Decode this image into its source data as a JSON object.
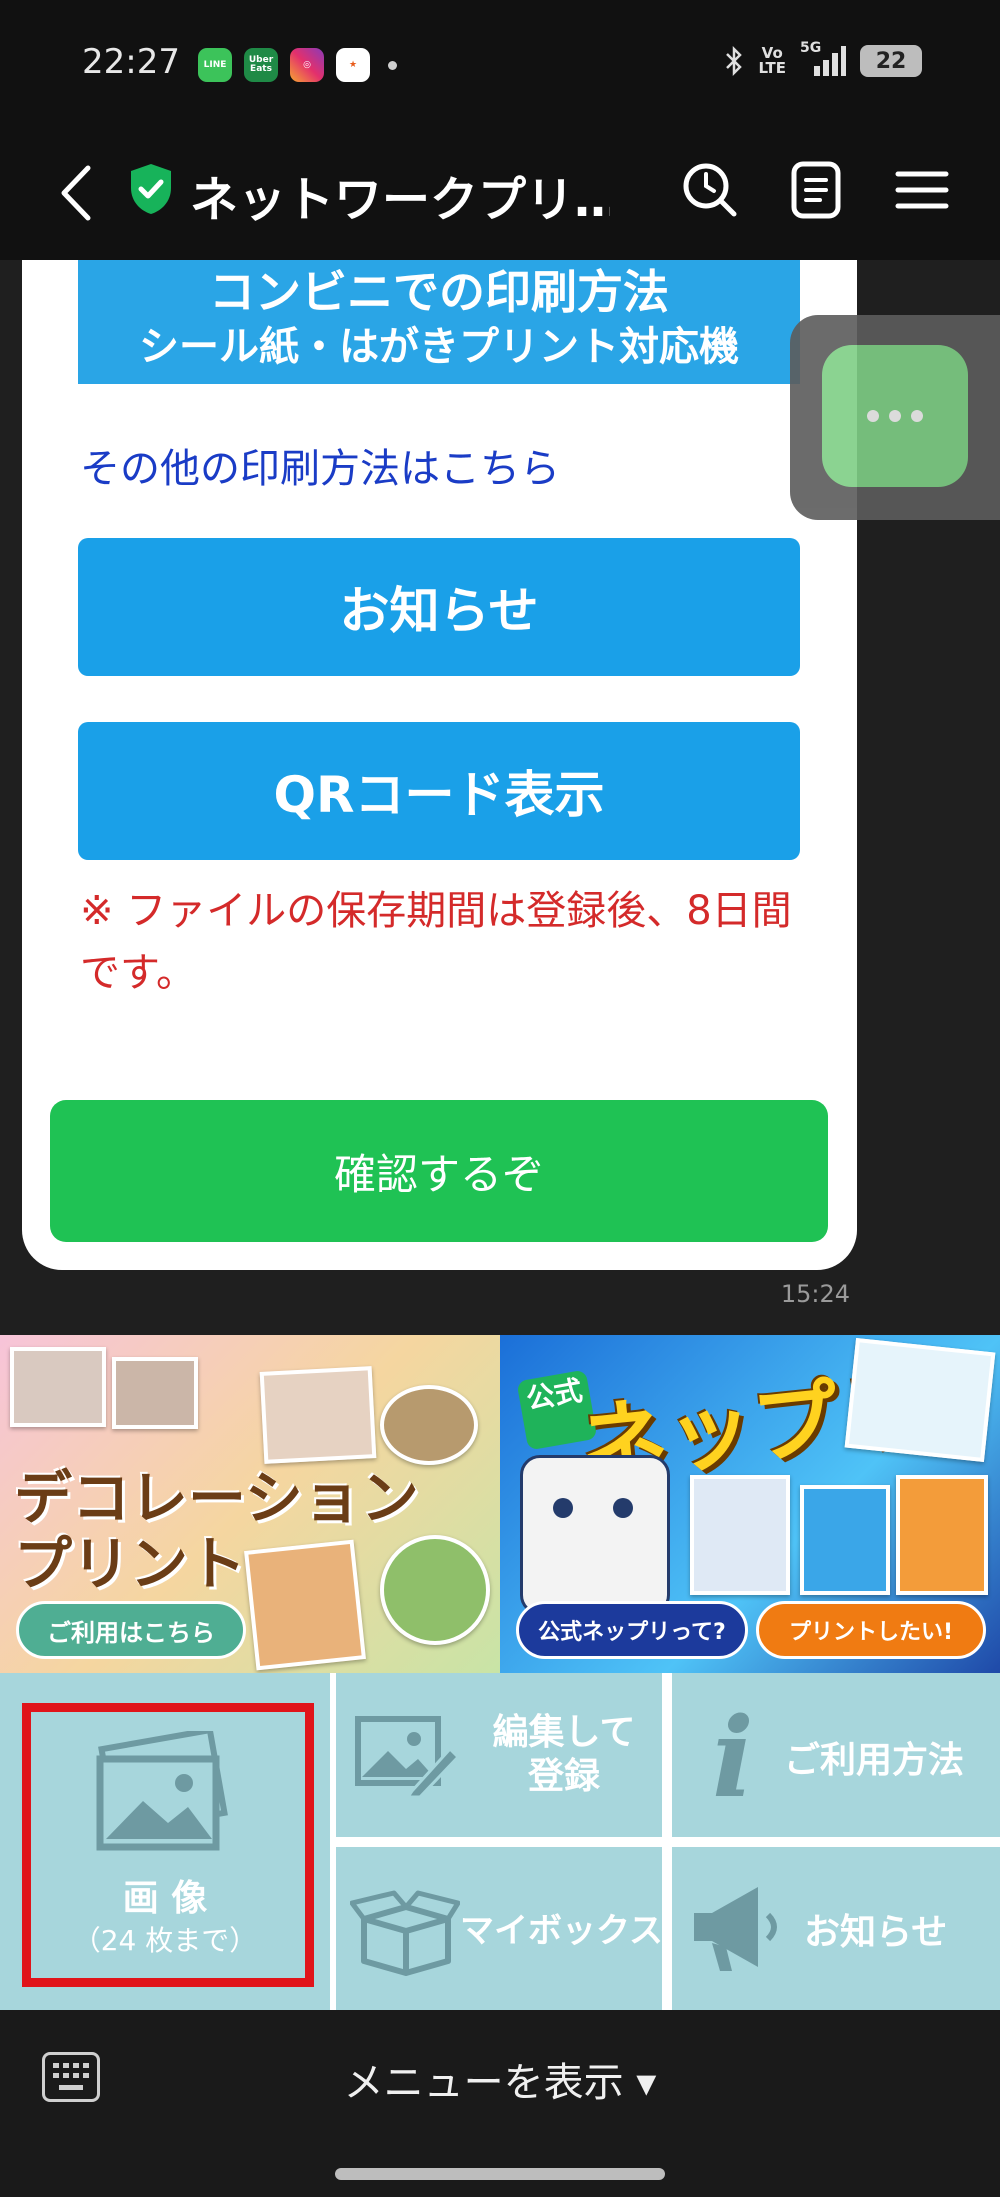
{
  "status_bar": {
    "time": "22:27",
    "app_icons": [
      "line-icon",
      "ubereats-icon",
      "instagram-icon",
      "app-icon"
    ],
    "network": "5G",
    "volte": "Vo LTE",
    "battery": "22"
  },
  "header": {
    "title": "ネットワークプリ…"
  },
  "message": {
    "banner_line1": "コンビニでの印刷方法",
    "banner_line2": "シール紙・はがきプリント対応機",
    "other_methods_link": "その他の印刷方法はこちら",
    "notice_button": "お知らせ",
    "qr_button": "QRコード表示",
    "storage_note": "※ ファイルの保存期間は登録後、8日間です。",
    "confirm_button": "確認するぞ",
    "timestamp": "15:24"
  },
  "banners": {
    "left": {
      "title_line1": "デコレーション",
      "title_line2": "プリント",
      "button": "ご利用はこちら"
    },
    "right": {
      "badge": "公式",
      "title": "ネップリ",
      "button_left": "公式ネップリって?",
      "button_right": "プリントしたい!"
    }
  },
  "rich_menu": {
    "image": {
      "label": "画 像",
      "sub": "（24 枚まで）"
    },
    "edit": {
      "label_line1": "編集して",
      "label_line2": "登録"
    },
    "usage": {
      "label": "ご利用方法"
    },
    "mybox": {
      "label": "マイボックス"
    },
    "notice": {
      "label": "お知らせ"
    }
  },
  "bottom_bar": {
    "menu_toggle": "メニューを表示 ▾"
  },
  "colors": {
    "blue_button": "#1aa0e8",
    "green_button": "#1fc254",
    "rich_menu_cell": "#a7d6dc",
    "highlight": "#e0141a",
    "note_red": "#d42a2a"
  }
}
